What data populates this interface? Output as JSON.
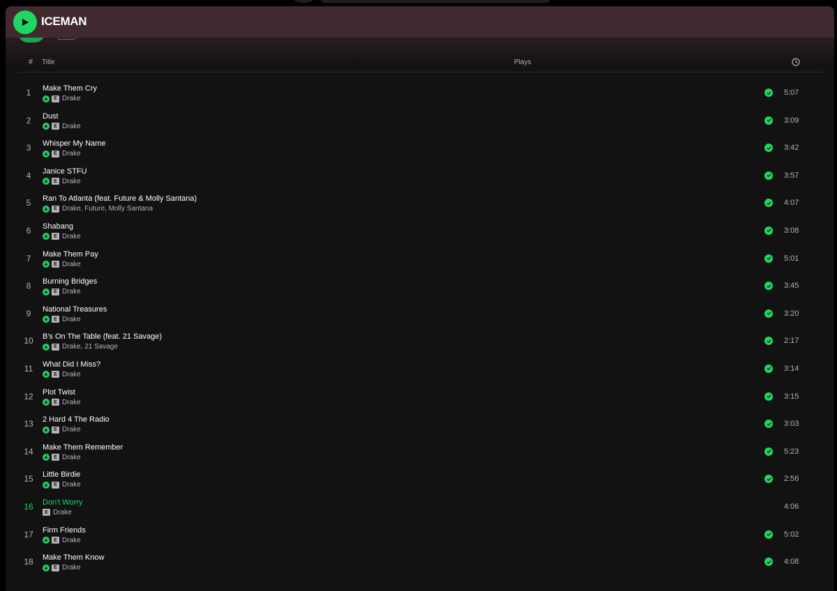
{
  "header": {
    "title": "ICEMAN"
  },
  "columns": {
    "hash": "#",
    "title": "Title",
    "plays": "Plays"
  },
  "icons": {
    "play": "play-icon",
    "clock": "clock-icon",
    "downloaded": "download-arrow-icon",
    "saved": "check-icon"
  },
  "colors": {
    "accent": "#1ed760",
    "header_bg": "#402a30",
    "panel_bg": "#121212",
    "text_secondary": "#b3b3b3"
  },
  "explicit_label": "E",
  "tracks": [
    {
      "num": "1",
      "title": "Make Them Cry",
      "artist": "Drake",
      "duration": "5:07",
      "downloaded": true,
      "saved": true,
      "playing": false
    },
    {
      "num": "2",
      "title": "Dust",
      "artist": "Drake",
      "duration": "3:09",
      "downloaded": true,
      "saved": true,
      "playing": false
    },
    {
      "num": "3",
      "title": "Whisper My Name",
      "artist": "Drake",
      "duration": "3:42",
      "downloaded": true,
      "saved": true,
      "playing": false
    },
    {
      "num": "4",
      "title": "Janice STFU",
      "artist": "Drake",
      "duration": "3:57",
      "downloaded": true,
      "saved": true,
      "playing": false
    },
    {
      "num": "5",
      "title": "Ran To Atlanta (feat. Future & Molly Santana)",
      "artist": "Drake, Future, Molly Santana",
      "duration": "4:07",
      "downloaded": true,
      "saved": true,
      "playing": false
    },
    {
      "num": "6",
      "title": "Shabang",
      "artist": "Drake",
      "duration": "3:08",
      "downloaded": true,
      "saved": true,
      "playing": false
    },
    {
      "num": "7",
      "title": "Make Them Pay",
      "artist": "Drake",
      "duration": "5:01",
      "downloaded": true,
      "saved": true,
      "playing": false
    },
    {
      "num": "8",
      "title": "Burning Bridges",
      "artist": "Drake",
      "duration": "3:45",
      "downloaded": true,
      "saved": true,
      "playing": false
    },
    {
      "num": "9",
      "title": "National Treasures",
      "artist": "Drake",
      "duration": "3:20",
      "downloaded": true,
      "saved": true,
      "playing": false
    },
    {
      "num": "10",
      "title": "B's On The Table (feat. 21 Savage)",
      "artist": "Drake, 21 Savage",
      "duration": "2:17",
      "downloaded": true,
      "saved": true,
      "playing": false
    },
    {
      "num": "11",
      "title": "What Did I Miss?",
      "artist": "Drake",
      "duration": "3:14",
      "downloaded": true,
      "saved": true,
      "playing": false
    },
    {
      "num": "12",
      "title": "Plot Twist",
      "artist": "Drake",
      "duration": "3:15",
      "downloaded": true,
      "saved": true,
      "playing": false
    },
    {
      "num": "13",
      "title": "2 Hard 4 The Radio",
      "artist": "Drake",
      "duration": "3:03",
      "downloaded": true,
      "saved": true,
      "playing": false
    },
    {
      "num": "14",
      "title": "Make Them Remember",
      "artist": "Drake",
      "duration": "5:23",
      "downloaded": true,
      "saved": true,
      "playing": false
    },
    {
      "num": "15",
      "title": "Little Birdie",
      "artist": "Drake",
      "duration": "2:56",
      "downloaded": true,
      "saved": true,
      "playing": false
    },
    {
      "num": "16",
      "title": "Don't Worry",
      "artist": "Drake",
      "duration": "4:06",
      "downloaded": false,
      "saved": false,
      "playing": true
    },
    {
      "num": "17",
      "title": "Firm Friends",
      "artist": "Drake",
      "duration": "5:02",
      "downloaded": true,
      "saved": true,
      "playing": false
    },
    {
      "num": "18",
      "title": "Make Them Know",
      "artist": "Drake",
      "duration": "4:08",
      "downloaded": true,
      "saved": true,
      "playing": false
    }
  ]
}
